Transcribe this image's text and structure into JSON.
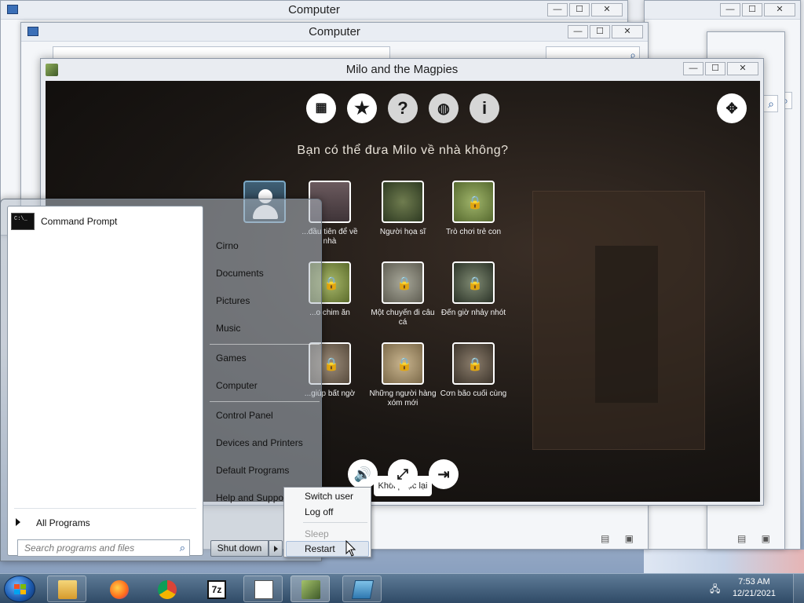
{
  "background_windows": [
    {
      "title": "Computer"
    },
    {
      "title": "Computer"
    }
  ],
  "game_window": {
    "title": "Milo and the Magpies",
    "question": "Bạn có thể đưa Milo về nhà không?",
    "restore_label": "Khôi phục lại",
    "levels": [
      {
        "label": "...đầu tiên để về nhà",
        "locked": false
      },
      {
        "label": "Người họa sĩ",
        "locked": false
      },
      {
        "label": "Trò chơi trẻ con",
        "locked": true
      },
      {
        "label": "...o chim ăn",
        "locked": true
      },
      {
        "label": "Một chuyến đi câu cá",
        "locked": true
      },
      {
        "label": "Đến giờ nhảy nhót",
        "locked": true
      },
      {
        "label": "...giúp bất ngờ",
        "locked": true
      },
      {
        "label": "Những người hàng xóm mới",
        "locked": true
      },
      {
        "label": "Cơn bão cuối cùng",
        "locked": true
      }
    ]
  },
  "start_menu": {
    "pinned": [
      {
        "label": "Command Prompt"
      }
    ],
    "all_programs_label": "All Programs",
    "search_placeholder": "Search programs and files",
    "right_items": [
      "Cirno",
      "Documents",
      "Pictures",
      "Music",
      "Games",
      "Computer",
      "Control Panel",
      "Devices and Printers",
      "Default Programs",
      "Help and Support"
    ],
    "shutdown_label": "Shut down"
  },
  "power_menu": {
    "items": [
      "Switch user",
      "Log off",
      "Sleep",
      "Restart"
    ]
  },
  "taskbar": {
    "time": "7:53 AM",
    "date": "12/21/2021"
  }
}
